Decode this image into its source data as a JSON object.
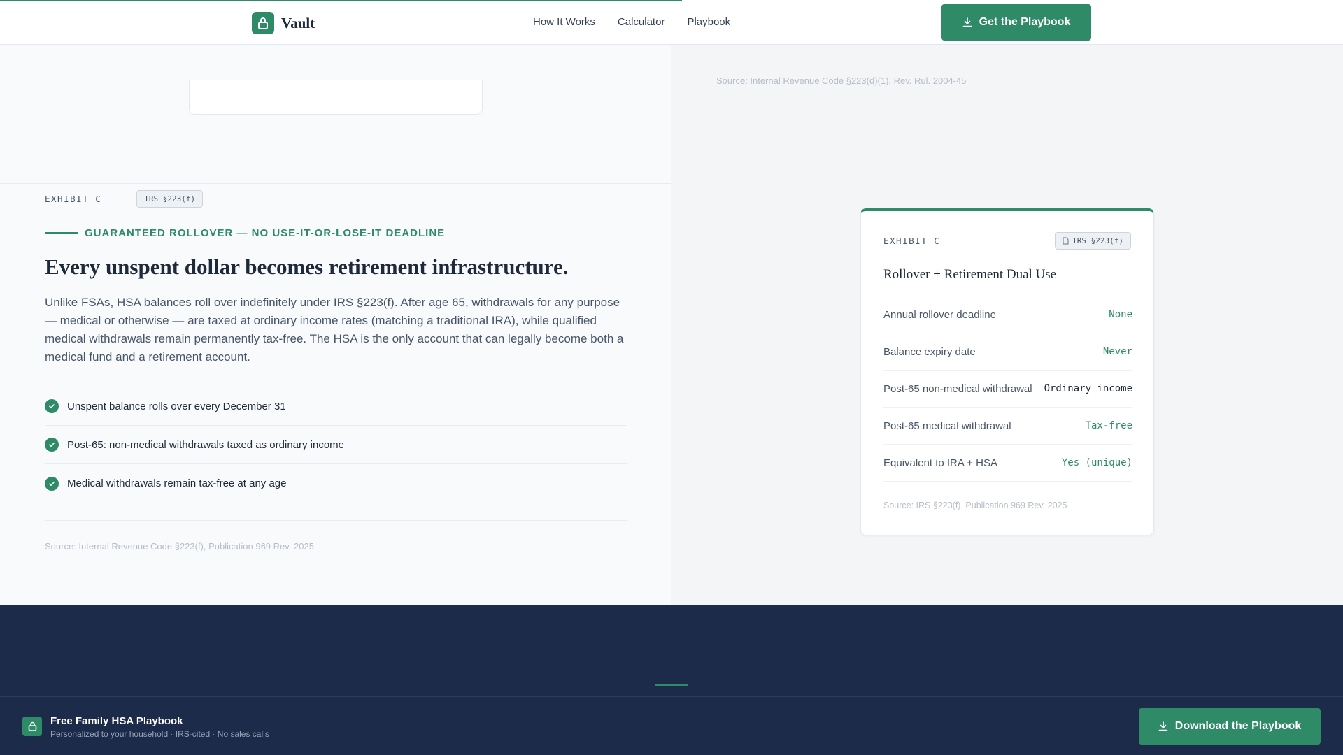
{
  "header": {
    "logo_text": "Vault",
    "nav": [
      "How It Works",
      "Calculator",
      "Playbook"
    ],
    "cta_label": "Get the Playbook"
  },
  "top_source": "Source: Internal Revenue Code §223(d)(1), Rev. Rul. 2004-45",
  "exhibit": {
    "label": "EXHIBIT C",
    "badge": "IRS §223(f)",
    "eyebrow": "GUARANTEED ROLLOVER — NO USE-IT-OR-LOSE-IT DEADLINE",
    "headline": "Every unspent dollar becomes retirement infrastructure.",
    "body": "Unlike FSAs, HSA balances roll over indefinitely under IRS §223(f). After age 65, withdrawals for any purpose — medical or otherwise — are taxed at ordinary income rates (matching a traditional IRA), while qualified medical withdrawals remain permanently tax-free. The HSA is the only account that can legally become both a medical fund and a retirement account.",
    "checklist": [
      "Unspent balance rolls over every December 31",
      "Post-65: non-medical withdrawals taxed as ordinary income",
      "Medical withdrawals remain tax-free at any age"
    ],
    "source": "Source: Internal Revenue Code §223(f), Publication 969 Rev. 2025"
  },
  "card": {
    "label": "EXHIBIT C",
    "badge": "IRS §223(f)",
    "title": "Rollover + Retirement Dual Use",
    "rows": [
      {
        "label": "Annual rollover deadline",
        "value": "None",
        "tone": "green"
      },
      {
        "label": "Balance expiry date",
        "value": "Never",
        "tone": "green"
      },
      {
        "label": "Post-65 non-medical withdrawal",
        "value": "Ordinary income",
        "tone": "dark"
      },
      {
        "label": "Post-65 medical withdrawal",
        "value": "Tax-free",
        "tone": "green"
      },
      {
        "label": "Equivalent to IRA + HSA",
        "value": "Yes (unique)",
        "tone": "green"
      }
    ],
    "source": "Source: IRS §223(f), Publication 969 Rev. 2025"
  },
  "sticky": {
    "title": "Free Family HSA Playbook",
    "subtitle": "Personalized to your household · IRS-cited · No sales calls",
    "cta_label": "Download the Playbook"
  },
  "colors": {
    "accent": "#2f8a68",
    "navy": "#1c2b4a"
  }
}
